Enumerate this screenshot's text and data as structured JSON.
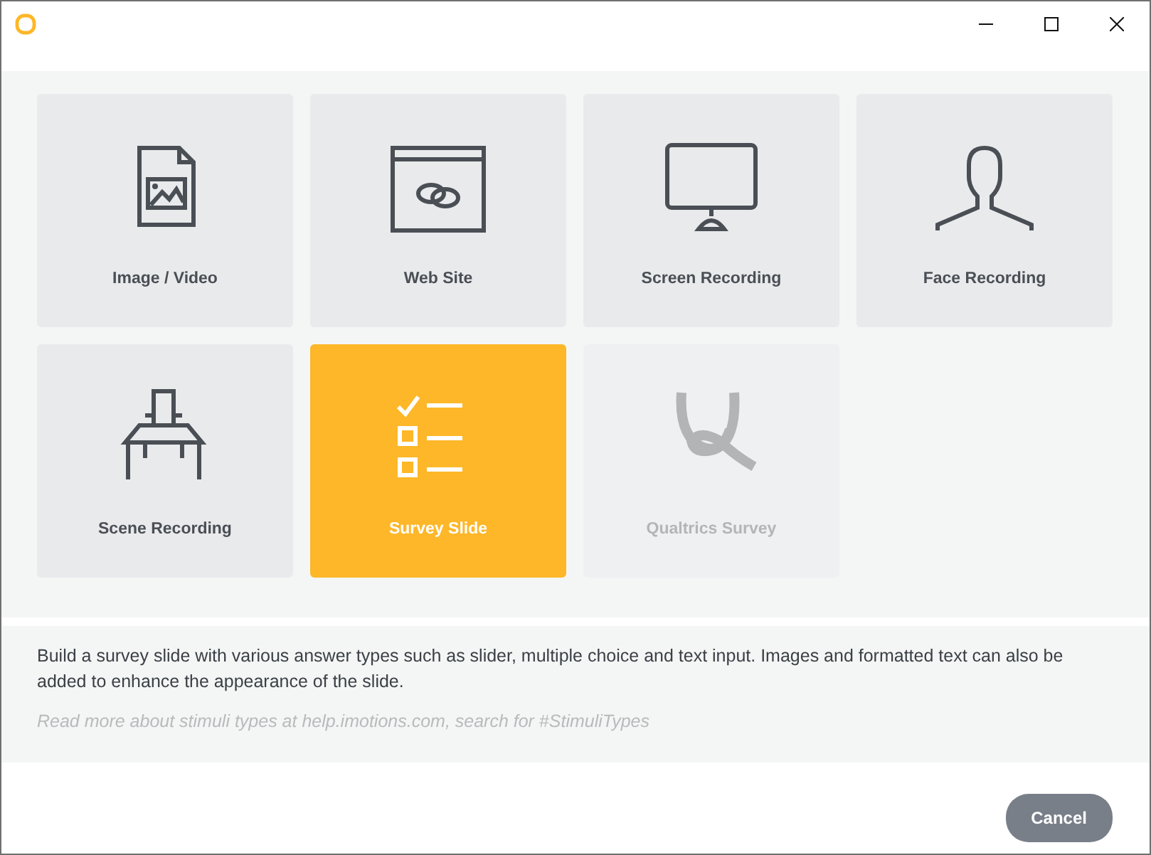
{
  "tiles": [
    {
      "label": "Image / Video",
      "kind": "image",
      "selected": false,
      "disabled": false
    },
    {
      "label": "Web Site",
      "kind": "web",
      "selected": false,
      "disabled": false
    },
    {
      "label": "Screen Recording",
      "kind": "screen",
      "selected": false,
      "disabled": false
    },
    {
      "label": "Face Recording",
      "kind": "face",
      "selected": false,
      "disabled": false
    },
    {
      "label": "Scene Recording",
      "kind": "scene",
      "selected": false,
      "disabled": false
    },
    {
      "label": "Survey Slide",
      "kind": "survey",
      "selected": true,
      "disabled": false
    },
    {
      "label": "Qualtrics Survey",
      "kind": "qualtrics",
      "selected": false,
      "disabled": true
    }
  ],
  "description": "Build a survey slide with various answer types such as slider, multiple choice and text input. Images and formatted text can also be added to enhance the appearance of the slide.",
  "hint": "Read more about stimuli types at help.imotions.com, search for #StimuliTypes",
  "buttons": [
    "Cancel"
  ]
}
